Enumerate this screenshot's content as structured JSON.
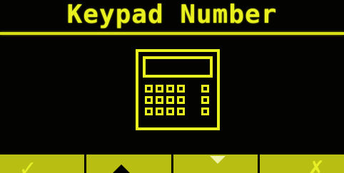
{
  "screen": {
    "title": "Keypad Number",
    "accent_color": "#e8f01e",
    "background_color": "#030302",
    "icon": "calculator-keypad-icon"
  },
  "softkeys": [
    {
      "name": "confirm",
      "label": "✓",
      "icon": "check-icon"
    },
    {
      "name": "up",
      "label": "",
      "icon": "up-arrow-icon"
    },
    {
      "name": "down",
      "label": "",
      "icon": "down-arrow-icon"
    },
    {
      "name": "cancel",
      "label": "✗",
      "icon": "close-icon"
    }
  ]
}
